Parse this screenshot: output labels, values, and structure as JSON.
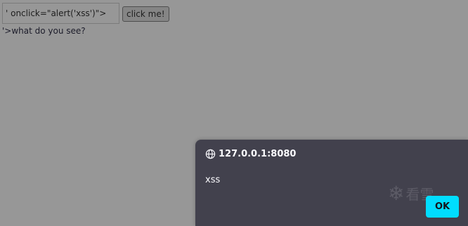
{
  "form": {
    "input_value": "' onclick=\"alert('xss')\">",
    "button_label": "click me!"
  },
  "output": {
    "reflected_text": "'>what do you see?"
  },
  "alert_dialog": {
    "origin": "127.0.0.1:8080",
    "origin_icon": "globe-icon",
    "message": "xss",
    "ok_label": "OK",
    "accent_color": "#00ddff",
    "watermark_icon": "snowflake-icon",
    "watermark_text": "看雪"
  },
  "colors": {
    "page_background": "#979797",
    "dialog_background": "#42414d"
  }
}
